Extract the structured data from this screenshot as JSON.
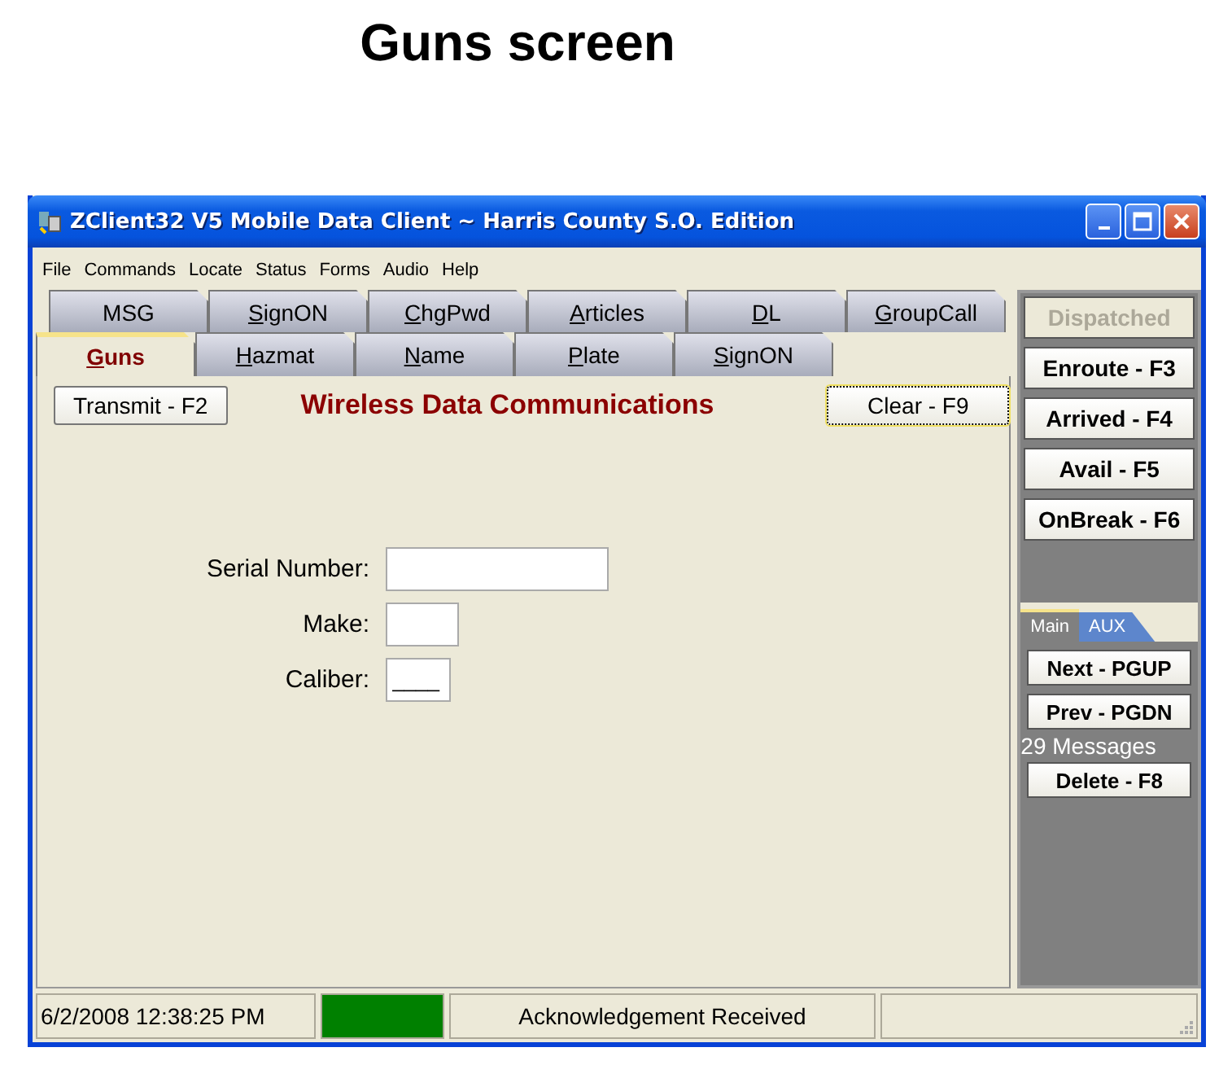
{
  "page_title": "Guns screen",
  "window": {
    "title": "ZClient32 V5 Mobile Data Client ~ Harris County S.O. Edition"
  },
  "menu": [
    "File",
    "Commands",
    "Locate",
    "Status",
    "Forms",
    "Audio",
    "Help"
  ],
  "tabs_back": [
    {
      "label": "MSG",
      "underline_key": false,
      "selected": false
    },
    {
      "label": "SignON",
      "underline_key": true,
      "selected": false
    },
    {
      "label": "ChgPwd",
      "underline_key": true,
      "selected": false
    },
    {
      "label": "Articles",
      "underline_key": true,
      "selected": false
    },
    {
      "label": "DL",
      "underline_key": true,
      "selected": false
    },
    {
      "label": "GroupCall",
      "underline_key": true,
      "selected": false
    }
  ],
  "tabs_front": [
    {
      "label": "Guns",
      "underline_key": true,
      "selected": true
    },
    {
      "label": "Hazmat",
      "underline_key": true,
      "selected": false
    },
    {
      "label": "Name",
      "underline_key": true,
      "selected": false
    },
    {
      "label": "Plate",
      "underline_key": true,
      "selected": false
    },
    {
      "label": "SignON",
      "underline_key": true,
      "selected": false
    }
  ],
  "transmit_button": "Transmit - F2",
  "heading": "Wireless Data Communications",
  "clear_button": {
    "label": "Clear - F9",
    "focused": true
  },
  "fields": [
    {
      "label": "Serial Number:",
      "kind": "wide"
    },
    {
      "label": "Make:",
      "kind": "small"
    },
    {
      "label": "Caliber:",
      "kind": "small",
      "value": "____"
    }
  ],
  "status_buttons": [
    {
      "label": "Dispatched",
      "disabled": true
    },
    {
      "label": "Enroute - F3",
      "disabled": false
    },
    {
      "label": "Arrived - F4",
      "disabled": false
    },
    {
      "label": "Avail - F5",
      "disabled": false
    },
    {
      "label": "OnBreak - F6",
      "disabled": false
    }
  ],
  "side_tabs": [
    {
      "label": "Main",
      "selected": true
    },
    {
      "label": "AUX",
      "selected": false
    }
  ],
  "message_buttons": [
    "Next - PGUP",
    "Prev - PGDN"
  ],
  "message_count": "29 Messages",
  "delete_button": "Delete - F8",
  "status_bar": {
    "datetime": "6/2/2008 12:38:25 PM",
    "message": "Acknowledgement Received"
  }
}
